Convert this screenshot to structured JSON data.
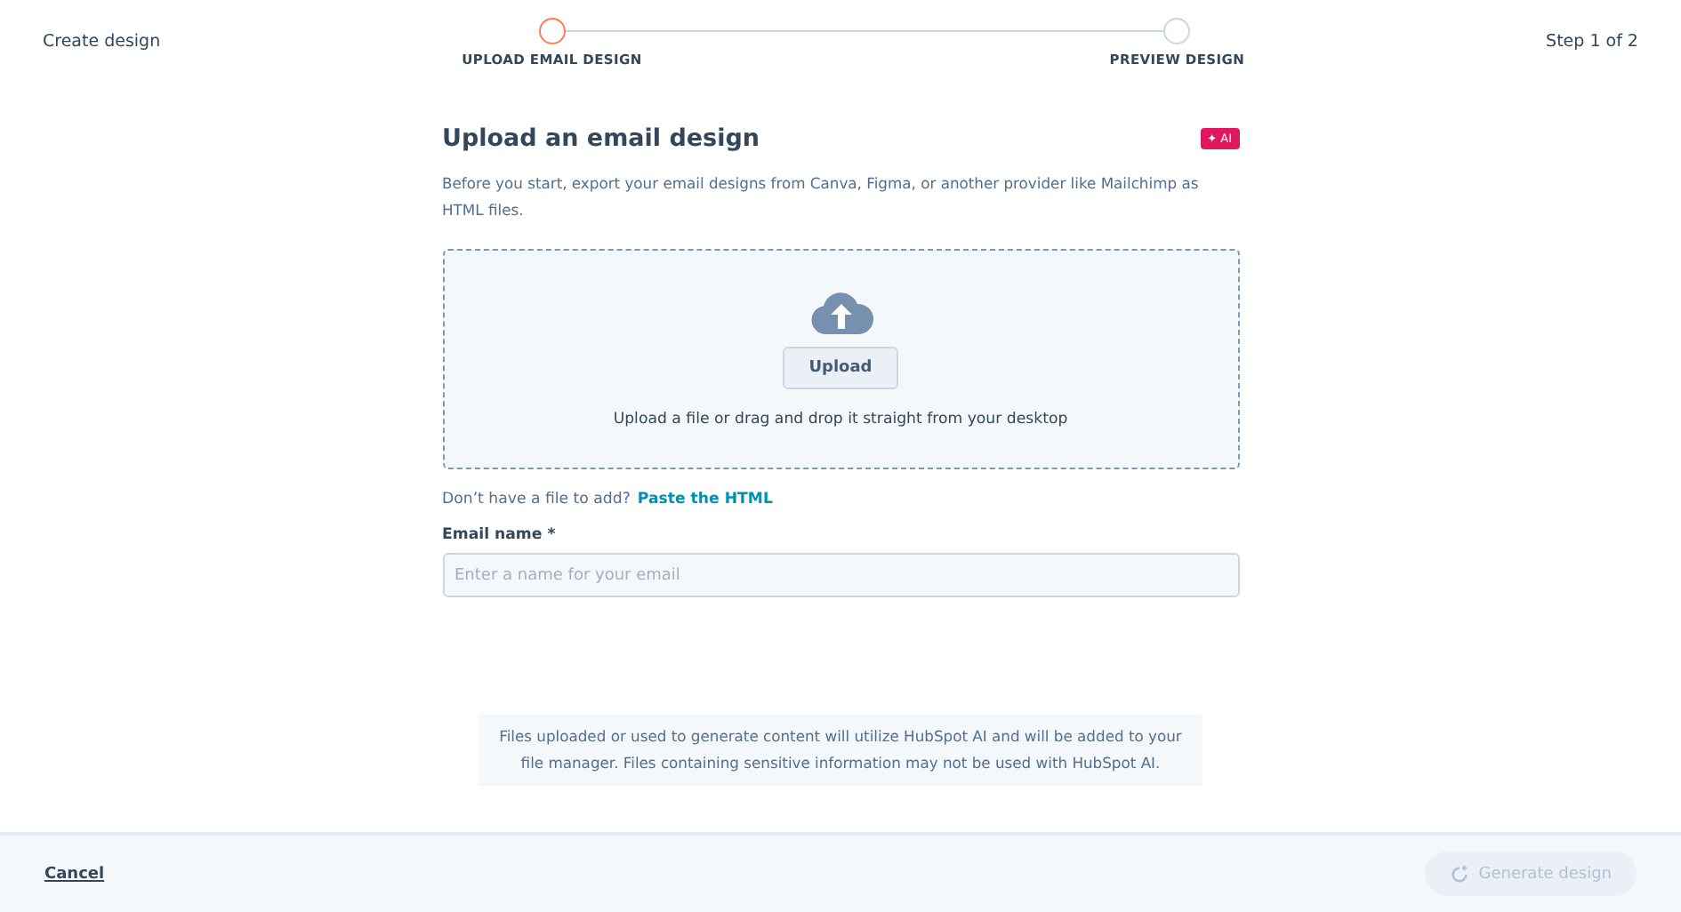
{
  "header": {
    "title": "Create design",
    "step_counter": "Step 1 of 2"
  },
  "steps": [
    {
      "label": "UPLOAD EMAIL DESIGN",
      "selected": true
    },
    {
      "label": "PREVIEW DESIGN",
      "selected": false
    }
  ],
  "panel": {
    "heading": "Upload an email design",
    "ai_badge": "✦ AI",
    "description": "Before you start, export your email designs from Canva, Figma, or another provider like Mailchimp as HTML files.",
    "dropzone": {
      "button": "Upload",
      "hint": "Upload a file or drag and drop it straight from your desktop"
    },
    "paste_prompt": "Don’t have a file to add?",
    "paste_link": "Paste the HTML",
    "email_name": {
      "label": "Email name *",
      "placeholder": "Enter a name for your email"
    }
  },
  "notice": "Files uploaded or used to generate content will utilize HubSpot AI and will be added to your file manager. Files containing sensitive information may not be used with HubSpot AI.",
  "footer": {
    "cancel": "Cancel",
    "generate": {
      "label": "Generate design",
      "disabled": true
    }
  }
}
